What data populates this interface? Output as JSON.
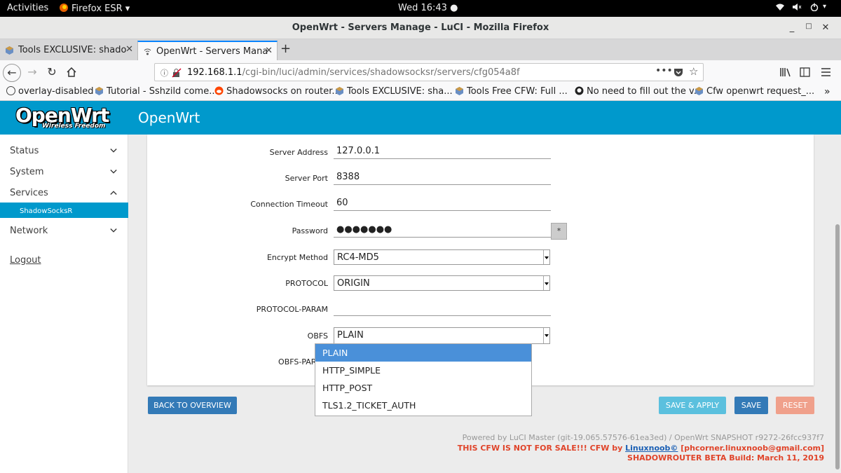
{
  "topbar": {
    "activities": "Activities",
    "app": "Firefox ESR",
    "clock": "Wed 16:43"
  },
  "window": {
    "title": "OpenWrt - Servers Manage - LuCI - Mozilla Firefox"
  },
  "tabs": [
    {
      "label": "Tools EXCLUSIVE: shado"
    },
    {
      "label": "OpenWrt - Servers Mana"
    }
  ],
  "url": {
    "host": "192.168.1.1",
    "path": "/cgi-bin/luci/admin/services/shadowsocksr/servers/cfg054a8f"
  },
  "bookmarks": [
    "overlay-disabled",
    "Tutorial - Sshzild come...",
    "Shadowsocks on router...",
    "Tools EXCLUSIVE: sha...",
    "Tools Free CFW: Full ...",
    "No need to fill out the v...",
    "Cfw openwrt request_..."
  ],
  "header": {
    "logo": "OpenWrt",
    "logo_sub": "Wireless Freedom",
    "brand": "OpenWrt"
  },
  "sidebar": {
    "items": [
      {
        "label": "Status"
      },
      {
        "label": "System"
      },
      {
        "label": "Services"
      },
      {
        "label": "ShadowSocksR"
      },
      {
        "label": "Network"
      }
    ],
    "logout": "Logout"
  },
  "form": {
    "server_address": {
      "label": "Server Address",
      "value": "127.0.0.1"
    },
    "server_port": {
      "label": "Server Port",
      "value": "8388"
    },
    "timeout": {
      "label": "Connection Timeout",
      "value": "60"
    },
    "password": {
      "label": "Password",
      "value": "●●●●●●●",
      "reveal": "*"
    },
    "encrypt": {
      "label": "Encrypt Method",
      "value": "RC4-MD5"
    },
    "protocol": {
      "label": "PROTOCOL",
      "value": "ORIGIN"
    },
    "protocol_param": {
      "label": "PROTOCOL-PARAM",
      "value": ""
    },
    "obfs": {
      "label": "OBFS",
      "value": "PLAIN",
      "options": [
        "PLAIN",
        "HTTP_SIMPLE",
        "HTTP_POST",
        "TLS1.2_TICKET_AUTH"
      ]
    },
    "obfs_param": {
      "label": "OBFS-PARAM"
    }
  },
  "buttons": {
    "back": "BACK TO OVERVIEW",
    "save_apply": "SAVE & APPLY",
    "save": "SAVE",
    "reset": "RESET"
  },
  "footer": {
    "powered": "Powered by LuCI Master (git-19.065.57576-61ea3ed) / OpenWrt SNAPSHOT r9272-26fcc937f7",
    "cfw_a": "THIS CFW IS NOT FOR SALE!!! CFW by ",
    "cfw_link": "Linuxnoob©",
    "cfw_b": " [phcorner.linuxnoob@gmail.com]",
    "build": "SHADOWROUTER BETA Build: March 11, 2019"
  },
  "colors": {
    "header": "#0099cc",
    "sidebar_active": "#0099cc",
    "save": "#337ab7",
    "save_apply": "#5bc0de",
    "reset": "#f0a08b",
    "footer_red": "#e0442a"
  }
}
